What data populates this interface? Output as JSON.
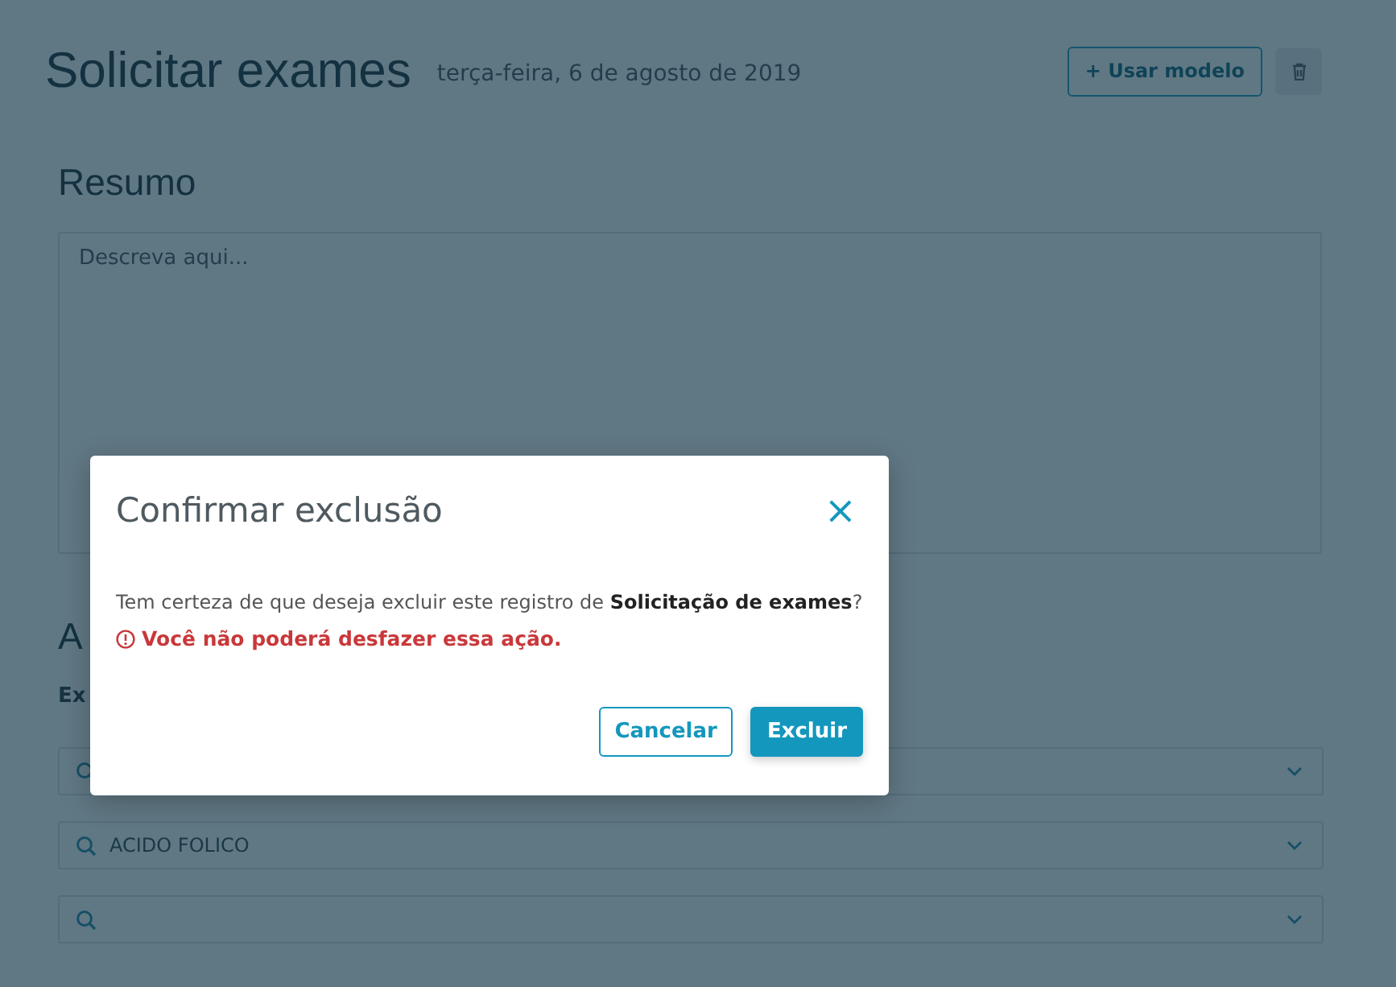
{
  "page": {
    "title": "Solicitar exames",
    "date": "terça-feira, 6 de agosto de 2019",
    "template_button": "+ Usar modelo"
  },
  "summary": {
    "heading": "Resumo",
    "placeholder": "Descreva aqui..."
  },
  "section": {
    "heading": "A",
    "label": "Ex"
  },
  "exam_fields": [
    {
      "kind": "empty"
    },
    {
      "kind": "filled",
      "value": "ACIDO FOLICO"
    },
    {
      "kind": "empty"
    }
  ],
  "dialog": {
    "title": "Confirmar exclusão",
    "close": "×",
    "message": "Tem certeza de que deseja excluir este registro de **Solicitação de exames**?",
    "warning": "Você não poderá desfazer essa ação.",
    "buttons": [
      {
        "label": "Cancelar",
        "kind": "secondary"
      },
      {
        "label": "Excluir",
        "kind": "primary"
      }
    ]
  }
}
